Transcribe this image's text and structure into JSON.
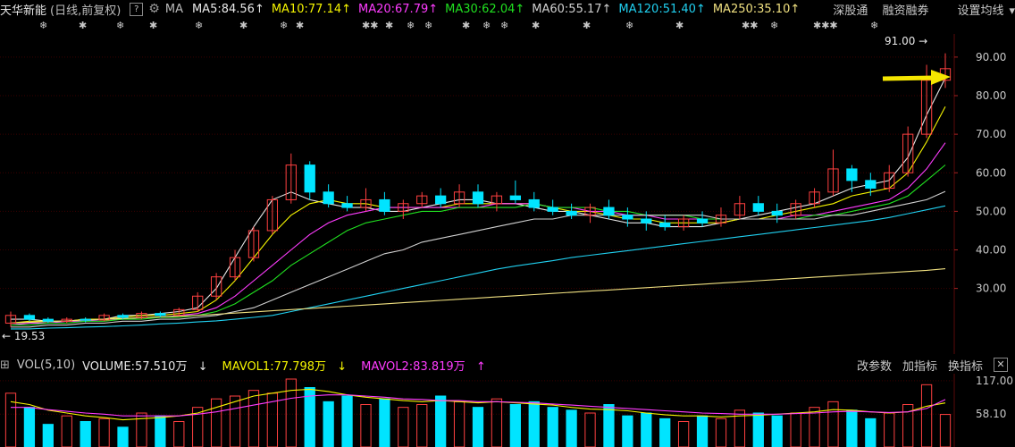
{
  "header": {
    "stock_name": "天华新能",
    "period": "(日线,前复权)",
    "help": "?",
    "ma_label": "MA",
    "indicators": [
      {
        "text": "MA5:84.56",
        "arrow": "↑",
        "color": "#e8e8e8"
      },
      {
        "text": "MA10:77.14",
        "arrow": "↑",
        "color": "#f5f500"
      },
      {
        "text": "MA20:67.79",
        "arrow": "↑",
        "color": "#ff3cff"
      },
      {
        "text": "MA30:62.04",
        "arrow": "↑",
        "color": "#20e020"
      },
      {
        "text": "MA60:55.17",
        "arrow": "↑",
        "color": "#d0d0d0"
      },
      {
        "text": "MA120:51.40",
        "arrow": "↑",
        "color": "#20d0f0"
      },
      {
        "text": "MA250:35.10",
        "arrow": "↑",
        "color": "#f0e080"
      }
    ],
    "links": [
      "深股通",
      "融资融券",
      "设置均线"
    ]
  },
  "ex_marks": [
    {
      "text": "❄"
    },
    {
      "text": "✱"
    },
    {
      "text": "❄"
    },
    {
      "text": "✱"
    },
    {
      "text": "❄"
    },
    {
      "text": "✱"
    },
    {
      "text": "❄"
    },
    {
      "text": "✱"
    },
    {
      "text": "✱✱"
    },
    {
      "text": "✱"
    },
    {
      "text": "❄"
    },
    {
      "text": "❄"
    },
    {
      "text": "✱"
    },
    {
      "text": "❄"
    },
    {
      "text": "❄"
    },
    {
      "text": "✱"
    },
    {
      "text": "✱"
    },
    {
      "text": "❄"
    },
    {
      "text": "✱"
    },
    {
      "text": "✱✱"
    },
    {
      "text": "❄"
    },
    {
      "text": "✱✱✱"
    },
    {
      "text": "❄"
    }
  ],
  "chart_data": {
    "type": "candlestick",
    "y_axis_ticks": [
      "90.00",
      "80.00",
      "70.00",
      "60.00",
      "50.00",
      "40.00",
      "30.00"
    ],
    "ylim": [
      16,
      96
    ],
    "max_label": "91.00",
    "min_label": "19.53",
    "annotation": "yellow-arrow",
    "up_color": "#ff4040",
    "down_color": "#00e4ff",
    "ma_lines": [
      {
        "name": "MA5",
        "color": "#e8e8e8",
        "values": [
          22,
          22,
          21.5,
          21.5,
          22,
          22,
          23,
          23,
          23.5,
          24,
          25,
          30,
          38,
          46,
          53,
          55,
          53,
          52,
          51,
          51,
          50,
          50,
          51,
          52,
          53,
          53,
          52,
          52,
          51,
          50,
          50,
          49,
          48,
          47,
          47,
          46,
          46,
          46,
          47,
          48,
          49,
          50,
          51,
          52,
          54,
          56,
          57,
          58,
          64,
          75,
          84.56
        ]
      },
      {
        "name": "MA10",
        "color": "#f5f500",
        "values": [
          21,
          21.5,
          21.5,
          21.5,
          22,
          22,
          22.5,
          23,
          23,
          23.5,
          24,
          27,
          32,
          38,
          44,
          49,
          52,
          53,
          52,
          52,
          51,
          51,
          51,
          51,
          52,
          52,
          52,
          52,
          52,
          51,
          50,
          50,
          49,
          48,
          48,
          47,
          47,
          47,
          47,
          48,
          48,
          49,
          50,
          51,
          52,
          54,
          55,
          56,
          60,
          68,
          77.14
        ]
      },
      {
        "name": "MA20",
        "color": "#ff3cff",
        "values": [
          20.5,
          21,
          21,
          21.5,
          21.5,
          22,
          22,
          22.5,
          22.5,
          23,
          23.5,
          25,
          28,
          32,
          36,
          40,
          44,
          47,
          49,
          50,
          51,
          51,
          51,
          51,
          51,
          51,
          52,
          52,
          52,
          51,
          51,
          50,
          50,
          49,
          49,
          48,
          48,
          48,
          48,
          48,
          48,
          48,
          49,
          49,
          50,
          51,
          52,
          53,
          56,
          61,
          67.79
        ]
      },
      {
        "name": "MA30",
        "color": "#20e020",
        "values": [
          20.5,
          20.5,
          21,
          21,
          21.5,
          21.5,
          22,
          22,
          22.5,
          22.5,
          23,
          24,
          26,
          29,
          32,
          36,
          39,
          42,
          45,
          47,
          48,
          49,
          50,
          50,
          51,
          51,
          51,
          51,
          52,
          51,
          51,
          51,
          50,
          50,
          49,
          49,
          49,
          48,
          48,
          48,
          48,
          48,
          48,
          49,
          49,
          50,
          51,
          52,
          54,
          58,
          62.04
        ]
      },
      {
        "name": "MA60",
        "color": "#d0d0d0",
        "values": [
          20,
          20,
          20.5,
          20.5,
          21,
          21,
          21.5,
          21.5,
          22,
          22,
          22.5,
          23,
          24,
          25,
          27,
          29,
          31,
          33,
          35,
          37,
          39,
          40,
          42,
          43,
          44,
          45,
          46,
          47,
          48,
          48,
          49,
          49,
          49,
          49,
          49,
          49,
          49,
          49,
          48,
          48,
          48,
          48,
          48,
          48,
          49,
          49,
          50,
          51,
          52,
          53,
          55.17
        ]
      },
      {
        "name": "MA120",
        "color": "#20d0f0",
        "values": [
          19.5,
          19.5,
          19.7,
          19.8,
          20,
          20.1,
          20.3,
          20.5,
          20.8,
          21,
          21.3,
          21.6,
          22,
          22.5,
          23,
          24,
          25,
          26,
          27,
          28,
          29,
          30,
          31,
          32,
          33,
          34,
          35,
          35.8,
          36.5,
          37.2,
          38,
          38.6,
          39.2,
          39.8,
          40.4,
          41,
          41.6,
          42.2,
          42.8,
          43.4,
          44,
          44.6,
          45.2,
          45.8,
          46.4,
          47,
          47.6,
          48.4,
          49.4,
          50.4,
          51.4
        ]
      },
      {
        "name": "MA250",
        "color": "#f0e080",
        "values": [
          21,
          21.2,
          21.4,
          21.6,
          21.8,
          22,
          22.2,
          22.4,
          22.6,
          22.8,
          23,
          23.3,
          23.6,
          23.9,
          24.2,
          24.5,
          24.8,
          25.1,
          25.4,
          25.7,
          26,
          26.3,
          26.6,
          26.9,
          27.2,
          27.5,
          27.8,
          28.1,
          28.4,
          28.7,
          29,
          29.3,
          29.6,
          29.9,
          30.2,
          30.5,
          30.8,
          31.1,
          31.4,
          31.7,
          32,
          32.3,
          32.6,
          32.9,
          33.2,
          33.5,
          33.8,
          34.1,
          34.4,
          34.7,
          35.1
        ]
      }
    ],
    "candles": [
      [
        21,
        23,
        24,
        20
      ],
      [
        23,
        22,
        23.5,
        21.5
      ],
      [
        22,
        21.5,
        22.5,
        21
      ],
      [
        21.5,
        22,
        22.5,
        21
      ],
      [
        22,
        21.8,
        22.5,
        21.2
      ],
      [
        21.8,
        23,
        23.5,
        21.5
      ],
      [
        23,
        22.5,
        23.5,
        22
      ],
      [
        22.5,
        23.5,
        24,
        22
      ],
      [
        23.5,
        23,
        24,
        22.5
      ],
      [
        23,
        24.5,
        25,
        22.8
      ],
      [
        24.5,
        28,
        29,
        24
      ],
      [
        28,
        33,
        34,
        27
      ],
      [
        33,
        38,
        40,
        32
      ],
      [
        38,
        45,
        46,
        37
      ],
      [
        45,
        53,
        54,
        44
      ],
      [
        53,
        62,
        65,
        52
      ],
      [
        62,
        55,
        63,
        53
      ],
      [
        55,
        52,
        57,
        51
      ],
      [
        52,
        51,
        54,
        50
      ],
      [
        51,
        53,
        56,
        50
      ],
      [
        53,
        50,
        55,
        49
      ],
      [
        50,
        52,
        53,
        48
      ],
      [
        52,
        54,
        55,
        51
      ],
      [
        54,
        52,
        56,
        51
      ],
      [
        52,
        55,
        57,
        51
      ],
      [
        55,
        52,
        57,
        51
      ],
      [
        52,
        54,
        55,
        50
      ],
      [
        54,
        53,
        58,
        52
      ],
      [
        53,
        51,
        55,
        50
      ],
      [
        51,
        50,
        53,
        49
      ],
      [
        50,
        49,
        52,
        48
      ],
      [
        49,
        51,
        52,
        47
      ],
      [
        51,
        49,
        53,
        48
      ],
      [
        49,
        48,
        51,
        46
      ],
      [
        48,
        47,
        50,
        45
      ],
      [
        47,
        46,
        49,
        45
      ],
      [
        46,
        48,
        49,
        45
      ],
      [
        48,
        47,
        50,
        46
      ],
      [
        47,
        49,
        51,
        46
      ],
      [
        49,
        52,
        54,
        48
      ],
      [
        52,
        50,
        54,
        49
      ],
      [
        50,
        49,
        52,
        47
      ],
      [
        49,
        52,
        53,
        48
      ],
      [
        52,
        55,
        56,
        51
      ],
      [
        55,
        61,
        66,
        54
      ],
      [
        61,
        58,
        62,
        55
      ],
      [
        58,
        56,
        60,
        54
      ],
      [
        56,
        60,
        62,
        55
      ],
      [
        60,
        70,
        72,
        59
      ],
      [
        70,
        84,
        88,
        69
      ],
      [
        84,
        87,
        91,
        82
      ]
    ]
  },
  "volume": {
    "label": "VOL(5,10)",
    "volume_text": "VOLUME:57.510万",
    "volume_arrow": "↓",
    "mavol1_text": "MAVOL1:77.798万",
    "mavol1_arrow": "↓",
    "mavol2_text": "MAVOL2:83.819万",
    "mavol2_arrow": "↑",
    "buttons": [
      "改参数",
      "加指标",
      "换指标"
    ],
    "close": "✕",
    "y_ticks": [
      "117.00",
      "58.10"
    ],
    "ylim": [
      0,
      120
    ],
    "values": [
      95,
      70,
      40,
      55,
      45,
      50,
      35,
      60,
      55,
      45,
      70,
      85,
      90,
      100,
      95,
      120,
      105,
      80,
      90,
      75,
      85,
      70,
      75,
      90,
      80,
      70,
      85,
      75,
      80,
      70,
      65,
      60,
      75,
      55,
      60,
      50,
      45,
      55,
      50,
      65,
      60,
      55,
      60,
      70,
      80,
      65,
      50,
      60,
      75,
      110,
      57.51
    ],
    "mavol1": [
      80,
      75,
      65,
      60,
      55,
      52,
      48,
      50,
      52,
      55,
      60,
      70,
      80,
      90,
      95,
      100,
      102,
      98,
      92,
      88,
      85,
      82,
      80,
      82,
      80,
      78,
      80,
      78,
      76,
      74,
      70,
      67,
      66,
      64,
      60,
      57,
      55,
      55,
      53,
      55,
      56,
      58,
      60,
      62,
      66,
      65,
      62,
      60,
      62,
      72,
      77.8
    ],
    "mavol2": [
      70,
      70,
      66,
      63,
      60,
      58,
      55,
      55,
      55,
      55,
      58,
      62,
      68,
      74,
      80,
      86,
      90,
      92,
      92,
      90,
      88,
      85,
      84,
      82,
      82,
      80,
      80,
      79,
      78,
      76,
      74,
      72,
      70,
      68,
      66,
      64,
      62,
      60,
      59,
      58,
      58,
      58,
      59,
      60,
      62,
      63,
      62,
      61,
      62,
      68,
      83.8
    ]
  }
}
